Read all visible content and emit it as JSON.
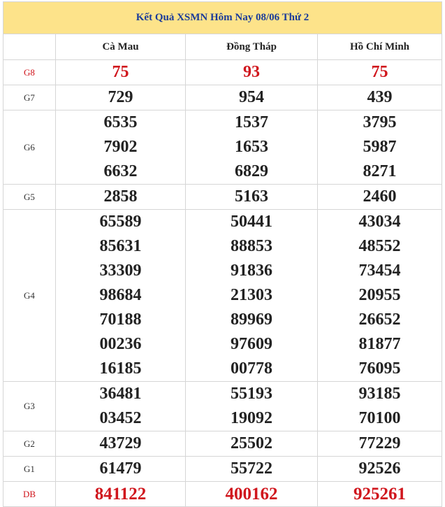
{
  "title": "Kết Quả XSMN Hôm Nay 08/06 Thứ 2",
  "provinces": [
    "Cà Mau",
    "Đồng Tháp",
    "Hồ Chí Minh"
  ],
  "prizes": [
    {
      "label": "G8",
      "red": true,
      "values": [
        [
          "75"
        ],
        [
          "93"
        ],
        [
          "75"
        ]
      ]
    },
    {
      "label": "G7",
      "red": false,
      "values": [
        [
          "729"
        ],
        [
          "954"
        ],
        [
          "439"
        ]
      ]
    },
    {
      "label": "G6",
      "red": false,
      "values": [
        [
          "6535",
          "7902",
          "6632"
        ],
        [
          "1537",
          "1653",
          "6829"
        ],
        [
          "3795",
          "5987",
          "8271"
        ]
      ]
    },
    {
      "label": "G5",
      "red": false,
      "values": [
        [
          "2858"
        ],
        [
          "5163"
        ],
        [
          "2460"
        ]
      ]
    },
    {
      "label": "G4",
      "red": false,
      "values": [
        [
          "65589",
          "85631",
          "33309",
          "98684",
          "70188",
          "00236",
          "16185"
        ],
        [
          "50441",
          "88853",
          "91836",
          "21303",
          "89969",
          "97609",
          "00778"
        ],
        [
          "43034",
          "48552",
          "73454",
          "20955",
          "26652",
          "81877",
          "76095"
        ]
      ]
    },
    {
      "label": "G3",
      "red": false,
      "values": [
        [
          "36481",
          "03452"
        ],
        [
          "55193",
          "19092"
        ],
        [
          "93185",
          "70100"
        ]
      ]
    },
    {
      "label": "G2",
      "red": false,
      "values": [
        [
          "43729"
        ],
        [
          "25502"
        ],
        [
          "77229"
        ]
      ]
    },
    {
      "label": "G1",
      "red": false,
      "values": [
        [
          "61479"
        ],
        [
          "55722"
        ],
        [
          "92526"
        ]
      ]
    },
    {
      "label": "DB",
      "red": true,
      "values": [
        [
          "841122"
        ],
        [
          "400162"
        ],
        [
          "925261"
        ]
      ]
    }
  ],
  "colors": {
    "header_bg": "#fde38a",
    "title_text": "#1a3b9a",
    "highlight": "#d0161d"
  }
}
